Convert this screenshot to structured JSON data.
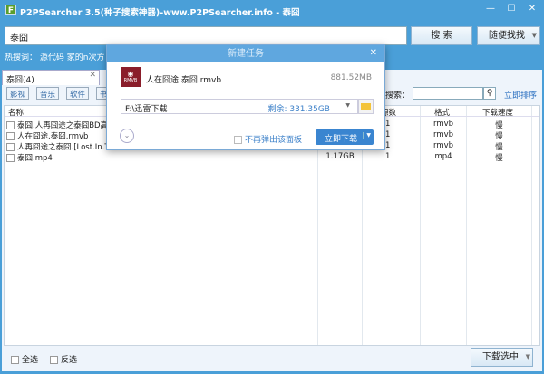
{
  "window": {
    "title": "P2PSearcher 3.5(种子搜索神器)-www.P2PSearcher.info - 泰囧",
    "logo": "F",
    "minimize": "—",
    "maximize": "☐",
    "close": "✕"
  },
  "search": {
    "value": "泰囧",
    "search_label": "搜 索",
    "random_label": "随便找找"
  },
  "hot": {
    "label": "热搜词：",
    "words": [
      "源代码",
      "家的n次方"
    ]
  },
  "tab": {
    "label": "泰囧(4)",
    "close": "✕"
  },
  "filters": [
    "影视",
    "音乐",
    "软件",
    "书"
  ],
  "result_search": {
    "label": "搜索：",
    "sort_label": "立即排序"
  },
  "table": {
    "headers": [
      "名称",
      "源数",
      "格式",
      "下载速度"
    ],
    "rows": [
      {
        "name": "泰囧.人再囧途之泰囧BD高",
        "size": "",
        "sources": "1",
        "format": "rmvb",
        "speed": "慢"
      },
      {
        "name": "人在囧途.泰囧.rmvb",
        "size": "",
        "sources": "1",
        "format": "rmvb",
        "speed": "慢"
      },
      {
        "name": "人再囧途之泰囧.[Lost.In.Th",
        "size": "",
        "sources": "1",
        "format": "rmvb",
        "speed": "慢"
      },
      {
        "name": "泰囧.mp4",
        "size": "1.17GB",
        "sources": "1",
        "format": "mp4",
        "speed": "慢"
      }
    ]
  },
  "footer": {
    "select_all": "全选",
    "invert": "反选",
    "download_selected": "下载选中"
  },
  "dialog": {
    "title": "新建任务",
    "file_name": "人在囧途.泰囧.rmvb",
    "file_size": "881.52MB",
    "file_icon_text": "RMVB",
    "path": "F:\\迅雷下载",
    "free_space": "剩余: 331.35GB",
    "no_popup": "不再弹出该面板",
    "download_now": "立即下载",
    "close": "✕"
  },
  "colors": {
    "titlebar": "#4a9fd8",
    "accent": "#3a7fc8"
  }
}
